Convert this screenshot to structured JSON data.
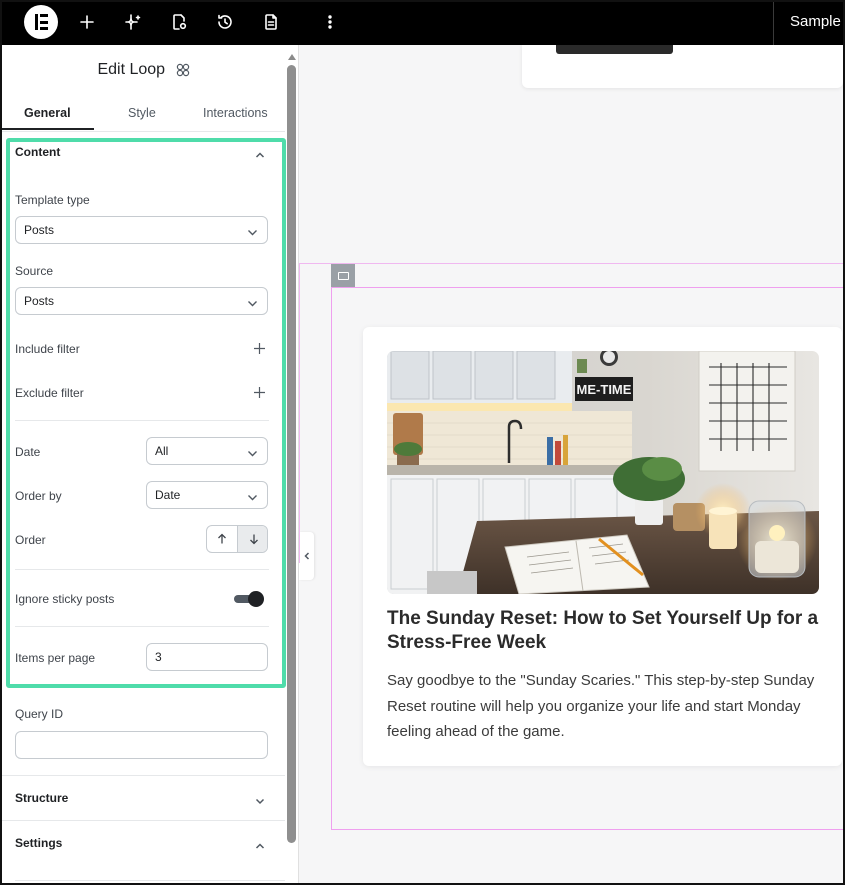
{
  "topbar": {
    "icons": [
      "elementor-logo",
      "plus-icon",
      "sparkle-icon",
      "page-settings-icon",
      "history-icon",
      "document-icon",
      "more-vertical-icon"
    ],
    "right_label": "Sample"
  },
  "panel": {
    "title": "Edit Loop",
    "tabs": [
      {
        "label": "General",
        "active": true
      },
      {
        "label": "Style",
        "active": false
      },
      {
        "label": "Interactions",
        "active": false
      }
    ],
    "content_section": {
      "heading": "Content",
      "template_type_label": "Template type",
      "template_type_value": "Posts",
      "source_label": "Source",
      "source_value": "Posts",
      "include_filter_label": "Include filter",
      "exclude_filter_label": "Exclude filter",
      "date_label": "Date",
      "date_value": "All",
      "order_by_label": "Order by",
      "order_by_value": "Date",
      "order_label": "Order",
      "order_selected": "desc",
      "ignore_sticky_label": "Ignore sticky posts",
      "ignore_sticky_on": true,
      "items_per_page_label": "Items per page",
      "items_per_page_value": "3",
      "query_id_label": "Query ID",
      "query_id_value": ""
    },
    "structure_heading": "Structure",
    "settings_heading": "Settings"
  },
  "canvas": {
    "post": {
      "title": "The Sunday Reset: How to Set Yourself Up for a Stress-Free Week",
      "excerpt": "Say goodbye to the \"Sunday Scaries.\" This step-by-step Sunday Reset routine will help you organize your life and start Monday feeling ahead of the game.",
      "image_sign_text": "ME-TIME"
    }
  },
  "colors": {
    "highlight": "#4fdcaa",
    "loop_outline": "#ef9fef",
    "topbar": "#000000"
  }
}
